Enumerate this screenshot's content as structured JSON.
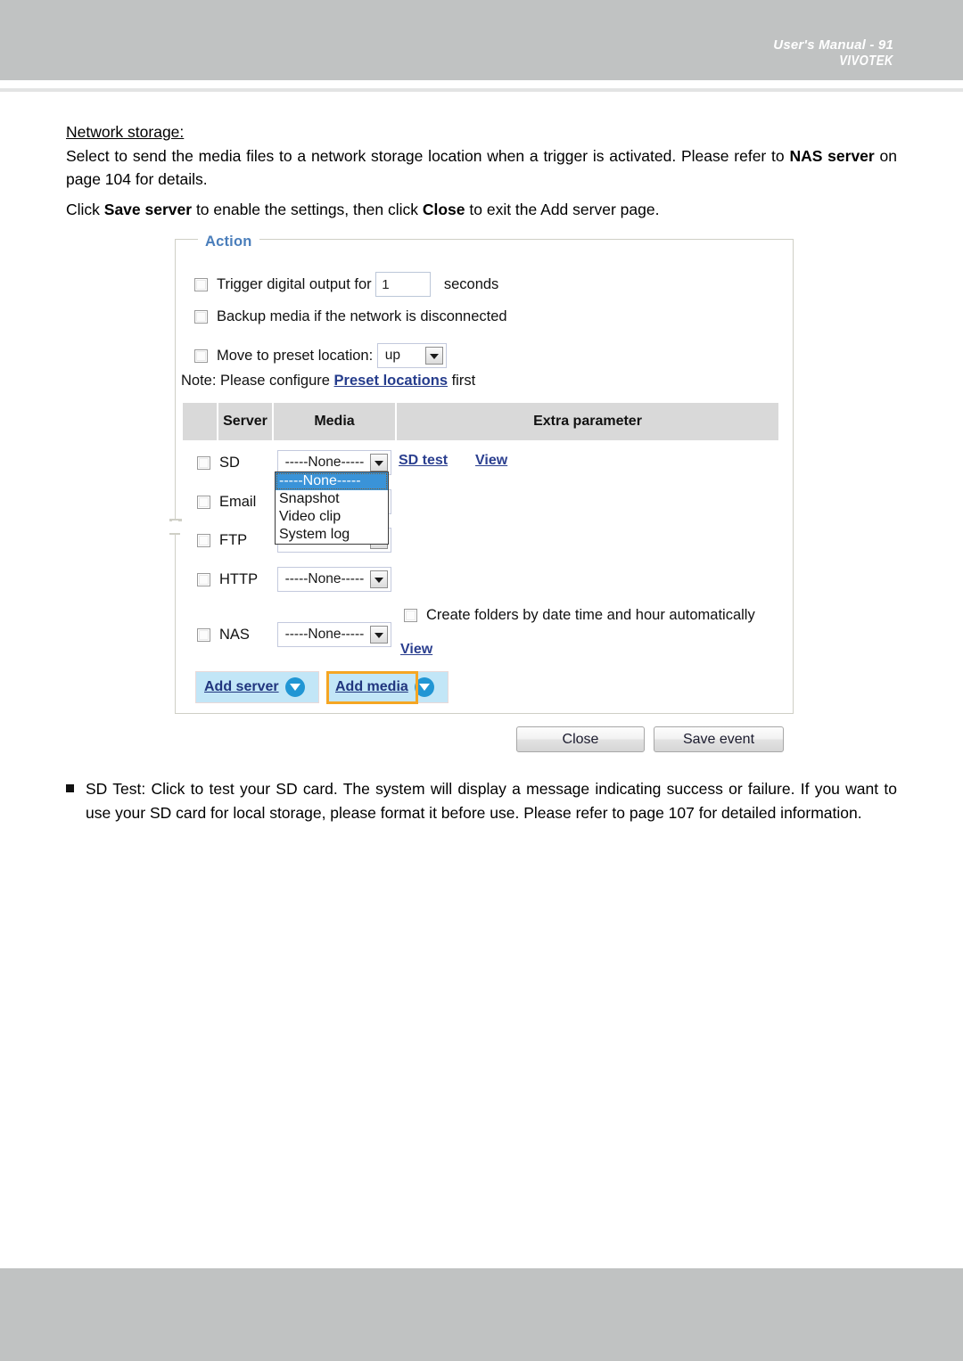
{
  "header": {
    "brand": "VIVOTEK"
  },
  "footer": {
    "text": "User's Manual - 91"
  },
  "intro": {
    "heading": "Network storage:",
    "para1_a": "Select to send the media files to a network storage location when a trigger is activated. Please refer to ",
    "para1_bold": "NAS server",
    "para1_b": " on page 104 for details.",
    "para2_a": "Click ",
    "para2_bold1": "Save server",
    "para2_b": " to enable the settings, then click ",
    "para2_bold2": "Close",
    "para2_c": " to exit the Add server page."
  },
  "action": {
    "legend": "Action",
    "trigger_label": "Trigger digital output for",
    "trigger_value": "1",
    "trigger_unit": "seconds",
    "backup_label": "Backup media if the network is disconnected",
    "preset_label": "Move to preset location:",
    "preset_value": "up",
    "note_a": "Note: Please configure ",
    "note_link": "Preset locations",
    "note_b": " first",
    "table": {
      "headers": [
        "",
        "Server",
        "Media",
        "Extra parameter"
      ],
      "rows": [
        {
          "server": "SD",
          "media": "-----None-----",
          "links": [
            "SD test",
            "View"
          ]
        },
        {
          "server": "Email",
          "media": "-----None-----",
          "links": []
        },
        {
          "server": "FTP",
          "media": "-----None-----",
          "links": []
        },
        {
          "server": "HTTP",
          "media": "-----None-----",
          "links": []
        },
        {
          "server": "NAS",
          "media": "-----None-----",
          "links": [
            "View"
          ]
        }
      ]
    },
    "dropdown_open": {
      "options": [
        "-----None-----",
        "Snapshot",
        "Video clip",
        "System log"
      ],
      "selected": "-----None-----"
    },
    "nas_checkbox_label": "Create folders by date time and hour automatically",
    "add_server_label": "Add server",
    "add_media_label": "Add media",
    "close_label": "Close",
    "save_event_label": "Save event",
    "highlight_color": "#f5a623",
    "legend_color": "#4a7ebb",
    "link_color": "#253c8c"
  },
  "bullet": {
    "text": "SD Test: Click to test your SD card. The system will display a message indicating success or failure. If you want to use your SD card for local storage, please format it before use. Please refer to page 107 for detailed information."
  }
}
